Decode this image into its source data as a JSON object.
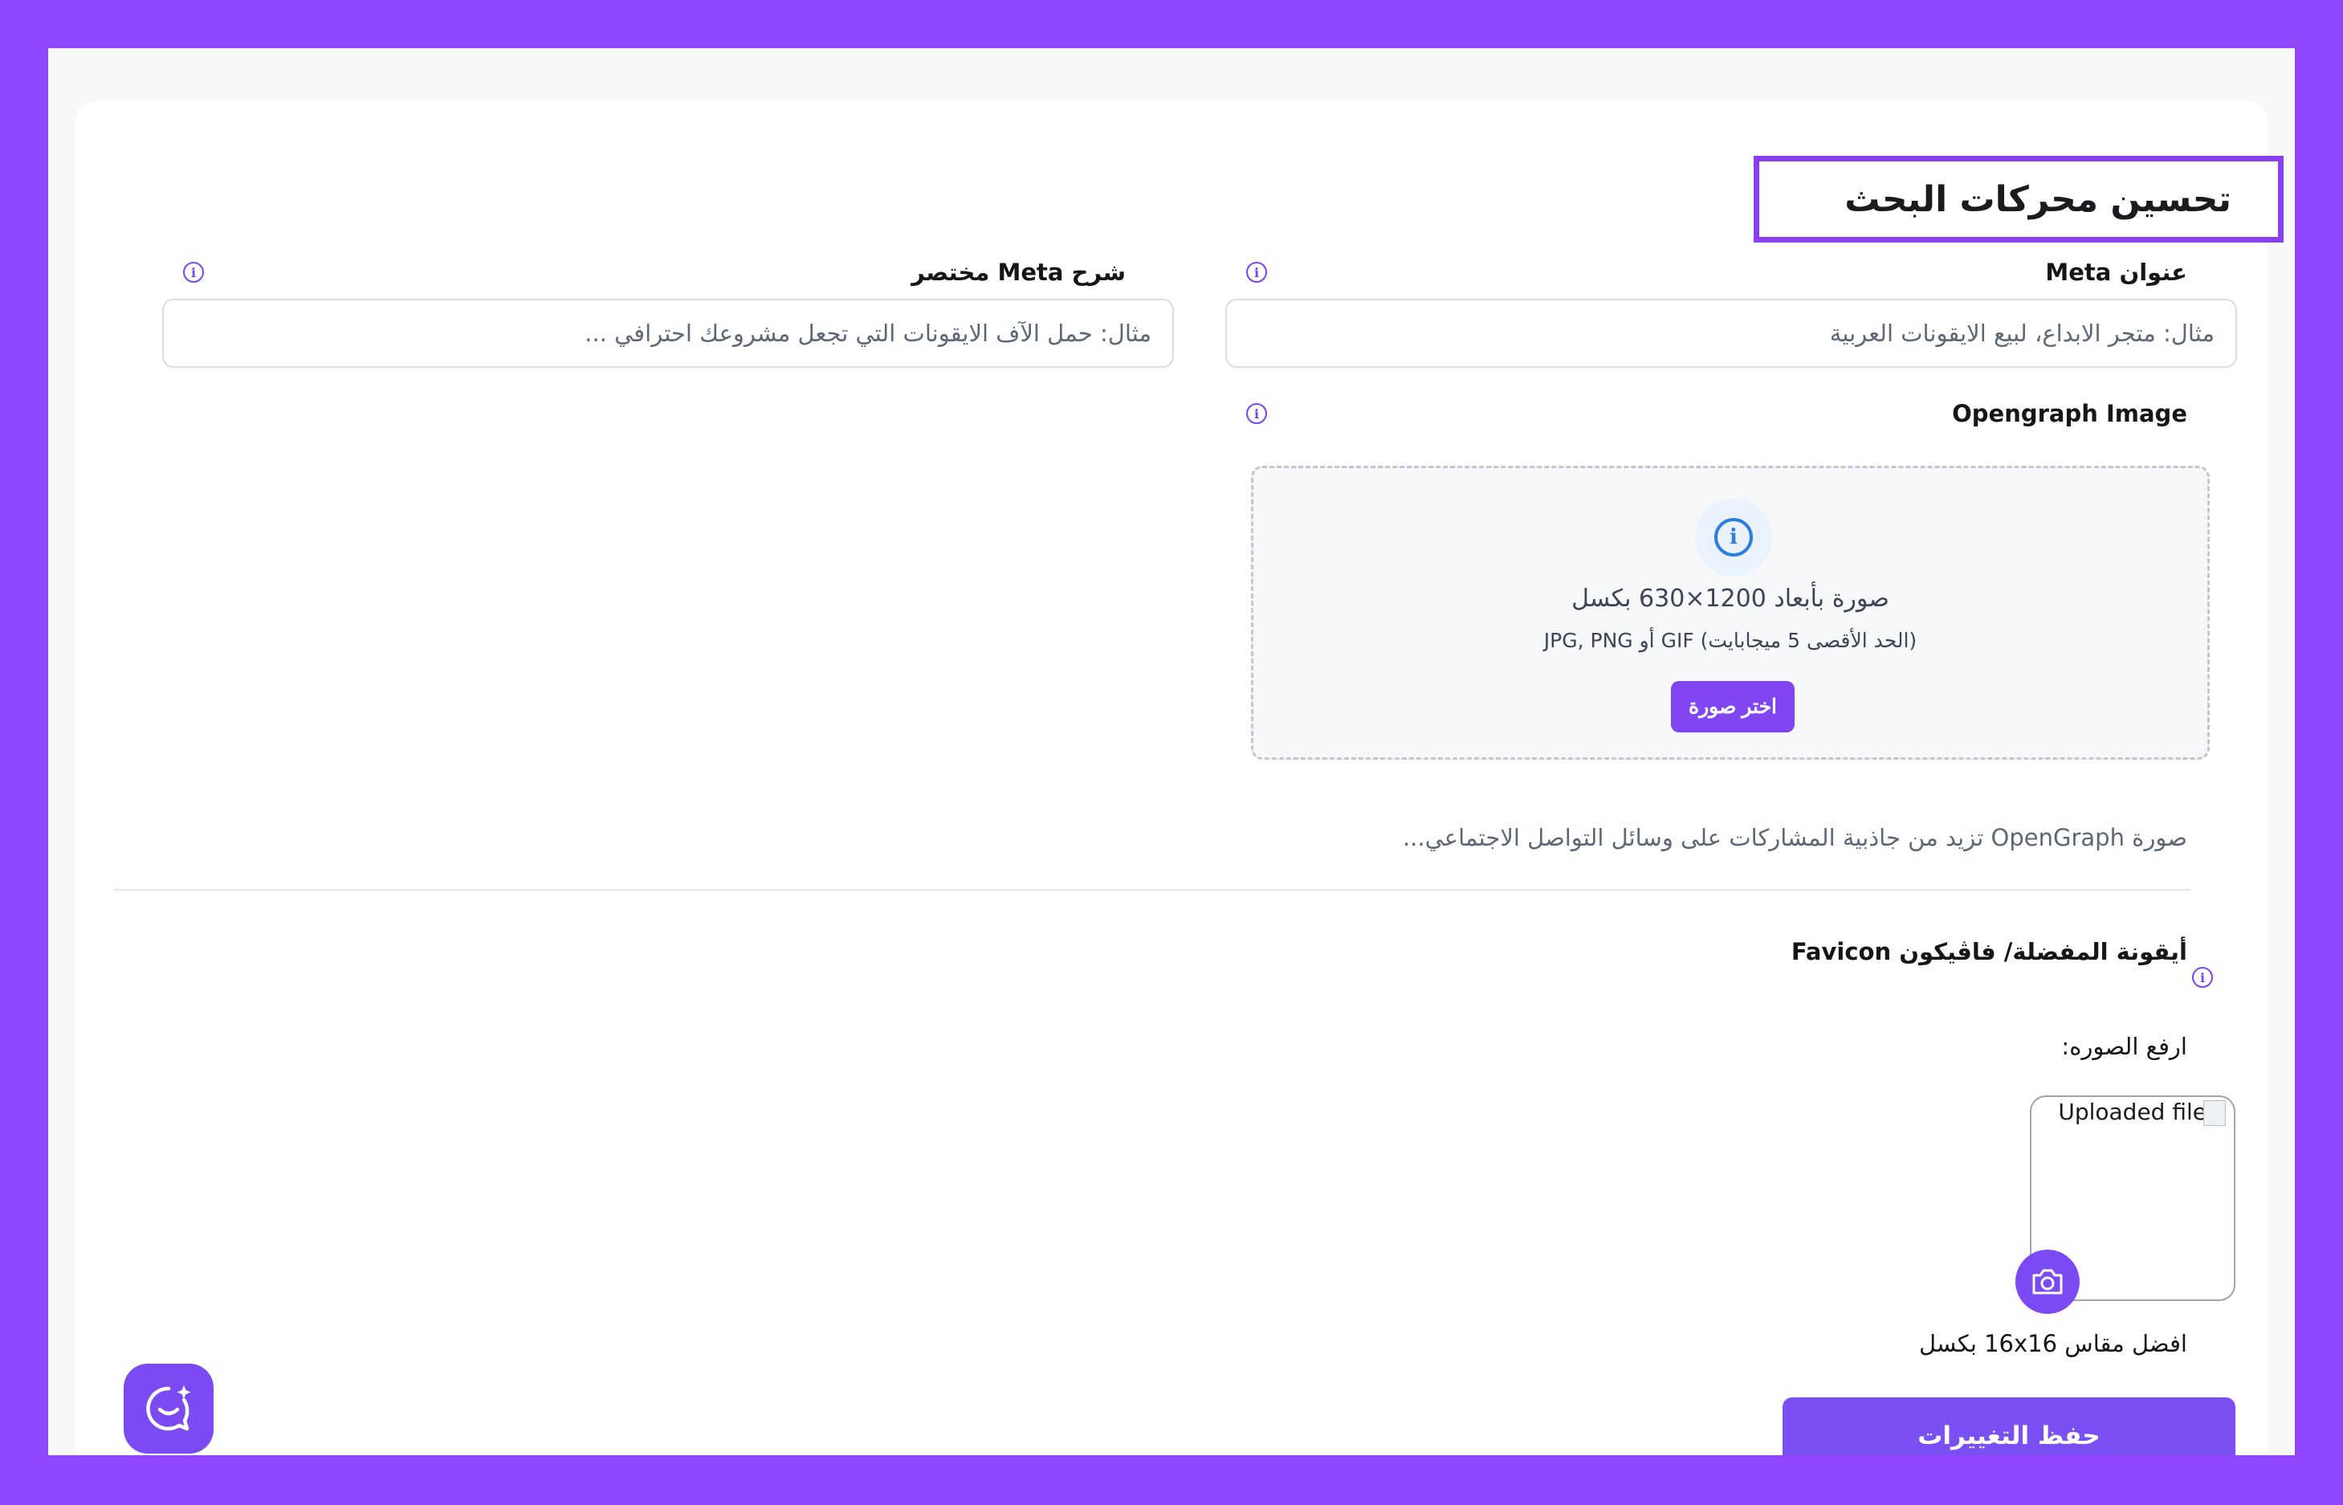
{
  "seo": {
    "title": "تحسين محركات البحث",
    "meta_title": {
      "label": "عنوان Meta",
      "placeholder": "مثال: متجر الابداع، لبيع الايقونات العربية"
    },
    "meta_description": {
      "label": "شرح Meta مختصر",
      "placeholder": "مثال: حمل الآف الايقونات التي تجعل مشروعك احترافي ..."
    },
    "opengraph": {
      "label": "Opengraph Image",
      "dropzone_title": "صورة بأبعاد 1200×630 بكسل",
      "dropzone_subtitle": "(الحد الأقصى 5 ميجابايت) GIF أو JPG, PNG",
      "choose_button": "اختر صورة",
      "note": "صورة OpenGraph تزيد من جاذبية المشاركات على وسائل التواصل الاجتماعي..."
    },
    "favicon": {
      "label": "أيقونة المفضلة/ فاڤيكون Favicon",
      "upload_label": "ارفع الصوره:",
      "image_alt": "Uploaded file",
      "size_hint": "افضل مقاس 16x16 بكسل"
    },
    "save_button": "حفظ التغييرات"
  },
  "icons": {
    "info": "info-icon",
    "camera": "camera-icon",
    "chat": "chat-assistant-icon"
  },
  "colors": {
    "page_background": "#9147ff",
    "accent": "#7a50f5",
    "info_blue": "#2a7de1"
  }
}
